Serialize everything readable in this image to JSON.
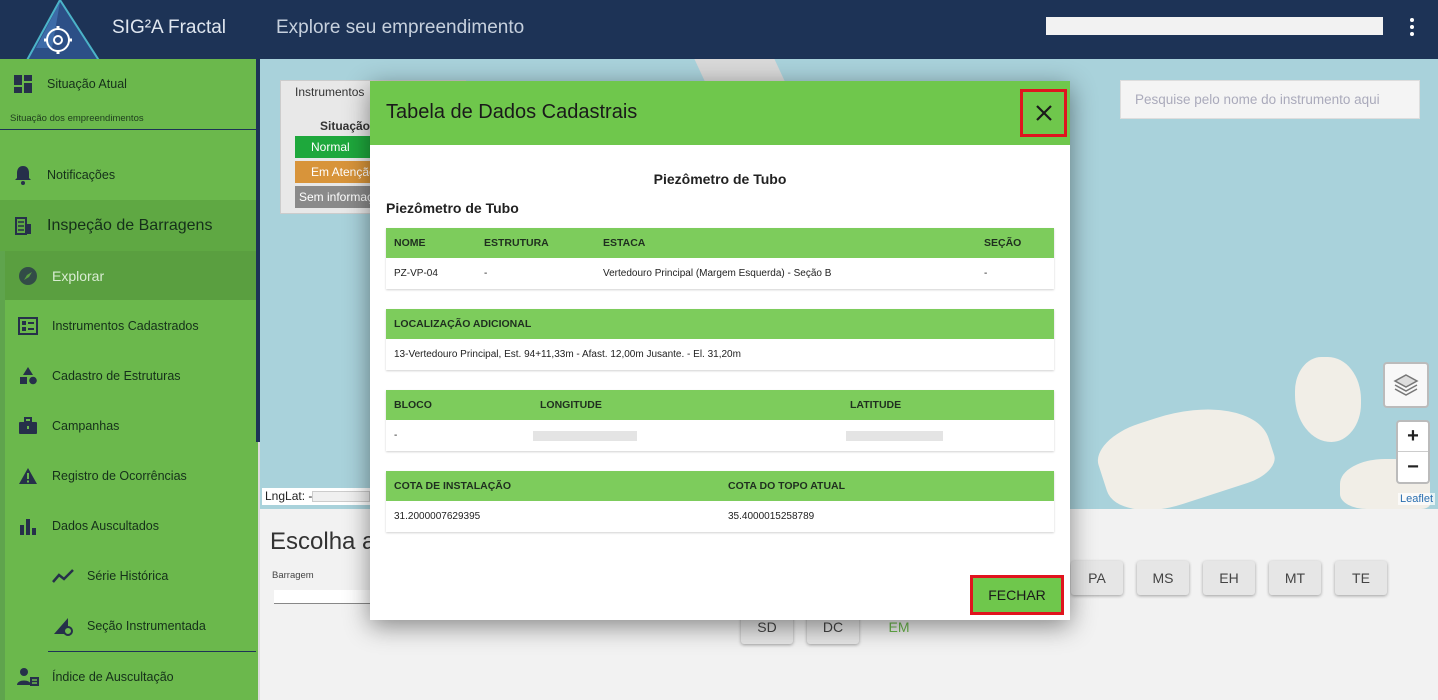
{
  "header": {
    "app_title": "SIG²A Fractal",
    "page_subtitle": "Explore seu empreendimento"
  },
  "sidebar": {
    "situacao_atual": "Situação Atual",
    "situacao_caption": "Situação dos empreendimentos",
    "notificacoes": "Notificações",
    "inspecao": "Inspeção de Barragens",
    "explorar": "Explorar",
    "instrumentos": "Instrumentos Cadastrados",
    "estruturas": "Cadastro de Estruturas",
    "campanhas": "Campanhas",
    "ocorrencias": "Registro de Ocorrências",
    "dados": "Dados Auscultados",
    "serie": "Série Histórica",
    "secao": "Seção Instrumentada",
    "indice": "Índice de Auscultação"
  },
  "map": {
    "search_placeholder": "Pesquise pelo nome do instrumento aqui",
    "zoom_in": "+",
    "zoom_out": "−",
    "attribution": "Leaflet",
    "lnglat_label": "LngLat: -"
  },
  "legend": {
    "tab": "Instrumentos",
    "header": "Situação",
    "rows": [
      {
        "label": "Normal",
        "color": "#1ea83c"
      },
      {
        "label": "Em Atenção",
        "color": "#d8943a"
      },
      {
        "label": "Sem informação",
        "color": "#8a8a8a"
      }
    ]
  },
  "bottom": {
    "title": "Escolha a",
    "barragem_label": "Barragem",
    "chips_row1": [
      "PA",
      "MS",
      "EH",
      "MT",
      "TE"
    ],
    "chips_row2": [
      "SD",
      "DC",
      "EM"
    ]
  },
  "modal": {
    "title": "Tabela de Dados Cadastrais",
    "center_title": "Piezômetro de Tubo",
    "section_title": "Piezômetro de Tubo",
    "t1": {
      "headers": [
        "NOME",
        "ESTRUTURA",
        "ESTACA",
        "SEÇÃO"
      ],
      "values": [
        "PZ-VP-04",
        "-",
        "Vertedouro Principal (Margem Esquerda) - Seção B",
        "-"
      ]
    },
    "t2": {
      "header": "LOCALIZAÇÃO ADICIONAL",
      "value": "13-Vertedouro Principal, Est. 94+11,33m - Afast. 12,00m Jusante. - El. 31,20m"
    },
    "t3": {
      "headers": [
        "BLOCO",
        "LONGITUDE",
        "LATITUDE"
      ],
      "values": [
        "-"
      ]
    },
    "t4": {
      "headers": [
        "COTA DE INSTALAÇÃO",
        "COTA DO TOPO ATUAL"
      ],
      "values": [
        "31.2000007629395",
        "35.4000015258789"
      ]
    },
    "fechar": "FECHAR"
  },
  "colors": {
    "header_bg": "#1d3356",
    "sidebar_bg": "#6bb84c",
    "modal_accent": "#6fc74c",
    "highlight": "#e0141e"
  }
}
